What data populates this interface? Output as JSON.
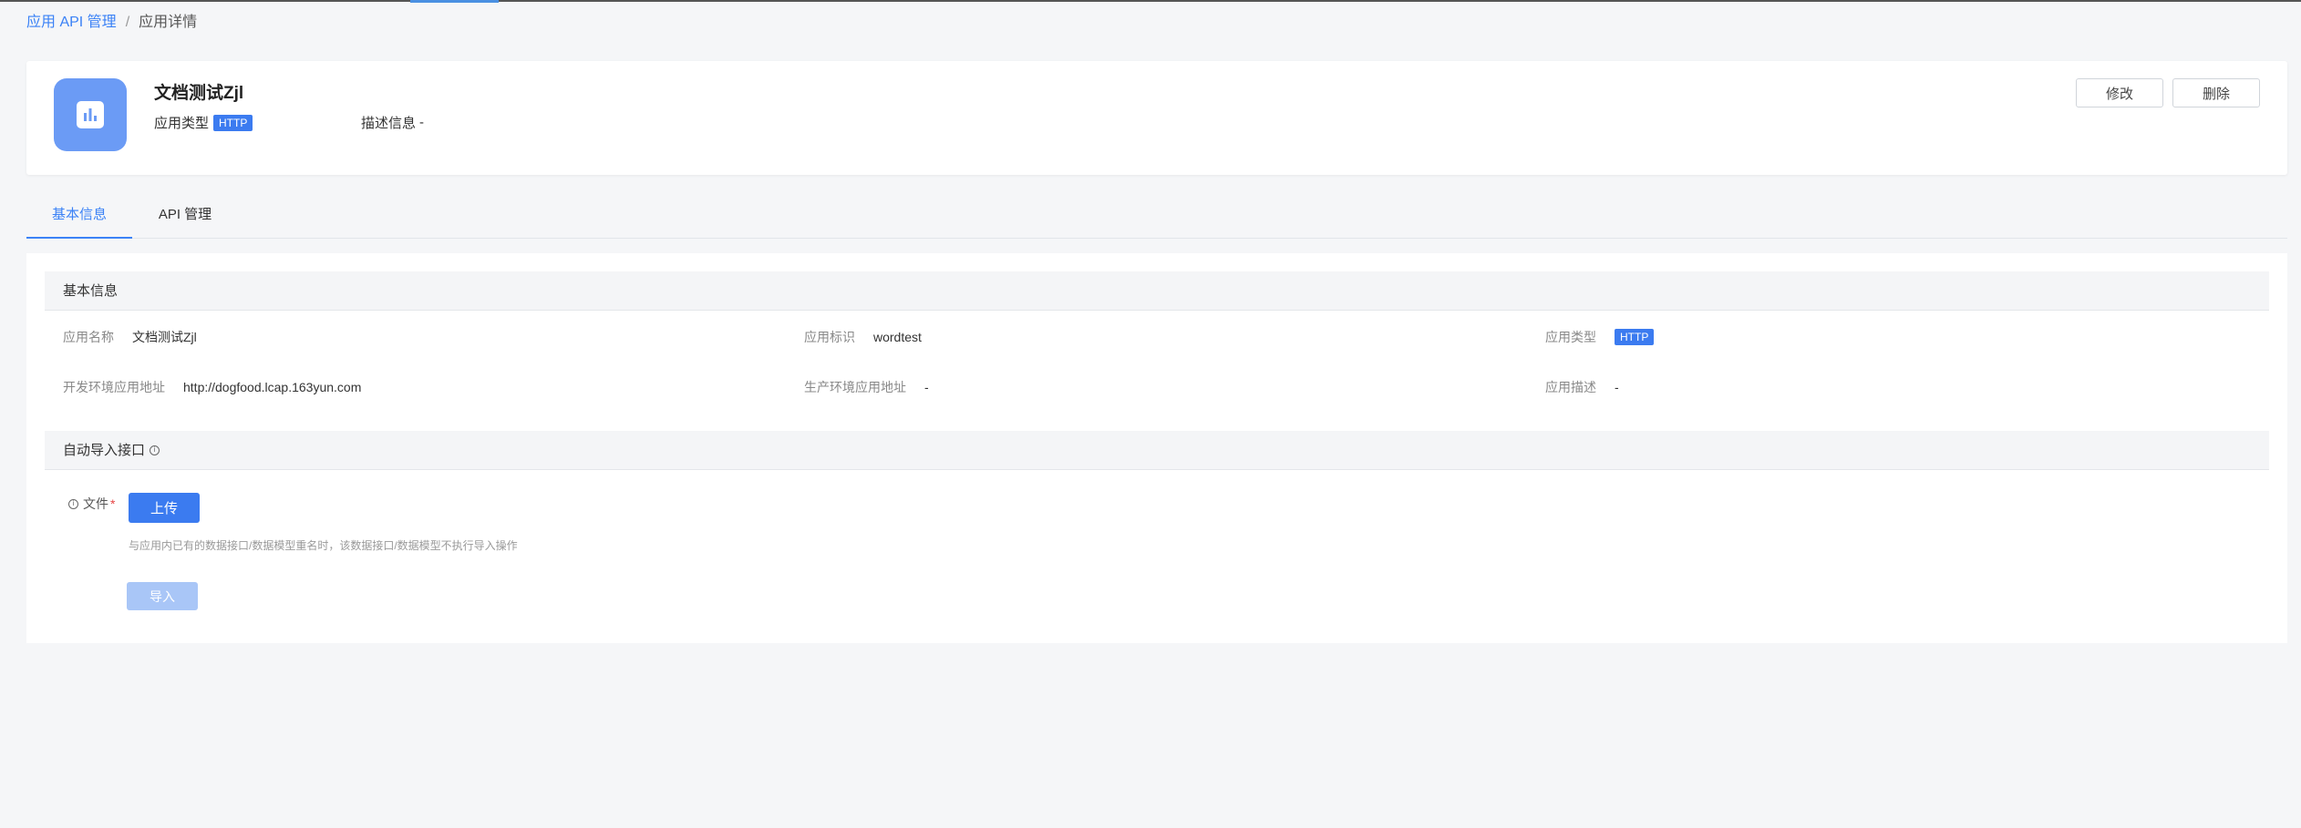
{
  "breadcrumb": {
    "parent": "应用 API 管理",
    "separator": "/",
    "current": "应用详情"
  },
  "app": {
    "name": "文档测试Zjl",
    "type_label": "应用类型",
    "type_value": "HTTP",
    "desc_label": "描述信息",
    "desc_value": "-",
    "icon": "bar-chart-icon"
  },
  "actions": {
    "edit_label": "修改",
    "delete_label": "删除"
  },
  "tabs": [
    {
      "label": "基本信息",
      "active": true
    },
    {
      "label": "API 管理",
      "active": false
    }
  ],
  "basic_info": {
    "title": "基本信息",
    "fields": {
      "name": {
        "label": "应用名称",
        "value": "文档测试Zjl"
      },
      "identifier": {
        "label": "应用标识",
        "value": "wordtest"
      },
      "type": {
        "label": "应用类型",
        "value": "HTTP"
      },
      "dev_url": {
        "label": "开发环境应用地址",
        "value": "http://dogfood.lcap.163yun.com"
      },
      "prod_url": {
        "label": "生产环境应用地址",
        "value": "-"
      },
      "description": {
        "label": "应用描述",
        "value": "-"
      }
    }
  },
  "auto_import": {
    "title": "自动导入接口",
    "file_label": "文件",
    "upload_label": "上传",
    "hint": "与应用内已有的数据接口/数据模型重名时，该数据接口/数据模型不执行导入操作",
    "import_label": "导入"
  },
  "colors": {
    "accent": "#3b82f6",
    "tag": "#3b7bf0",
    "icon_bg": "#6b9bf5",
    "disabled_button": "#a9c6f7"
  }
}
